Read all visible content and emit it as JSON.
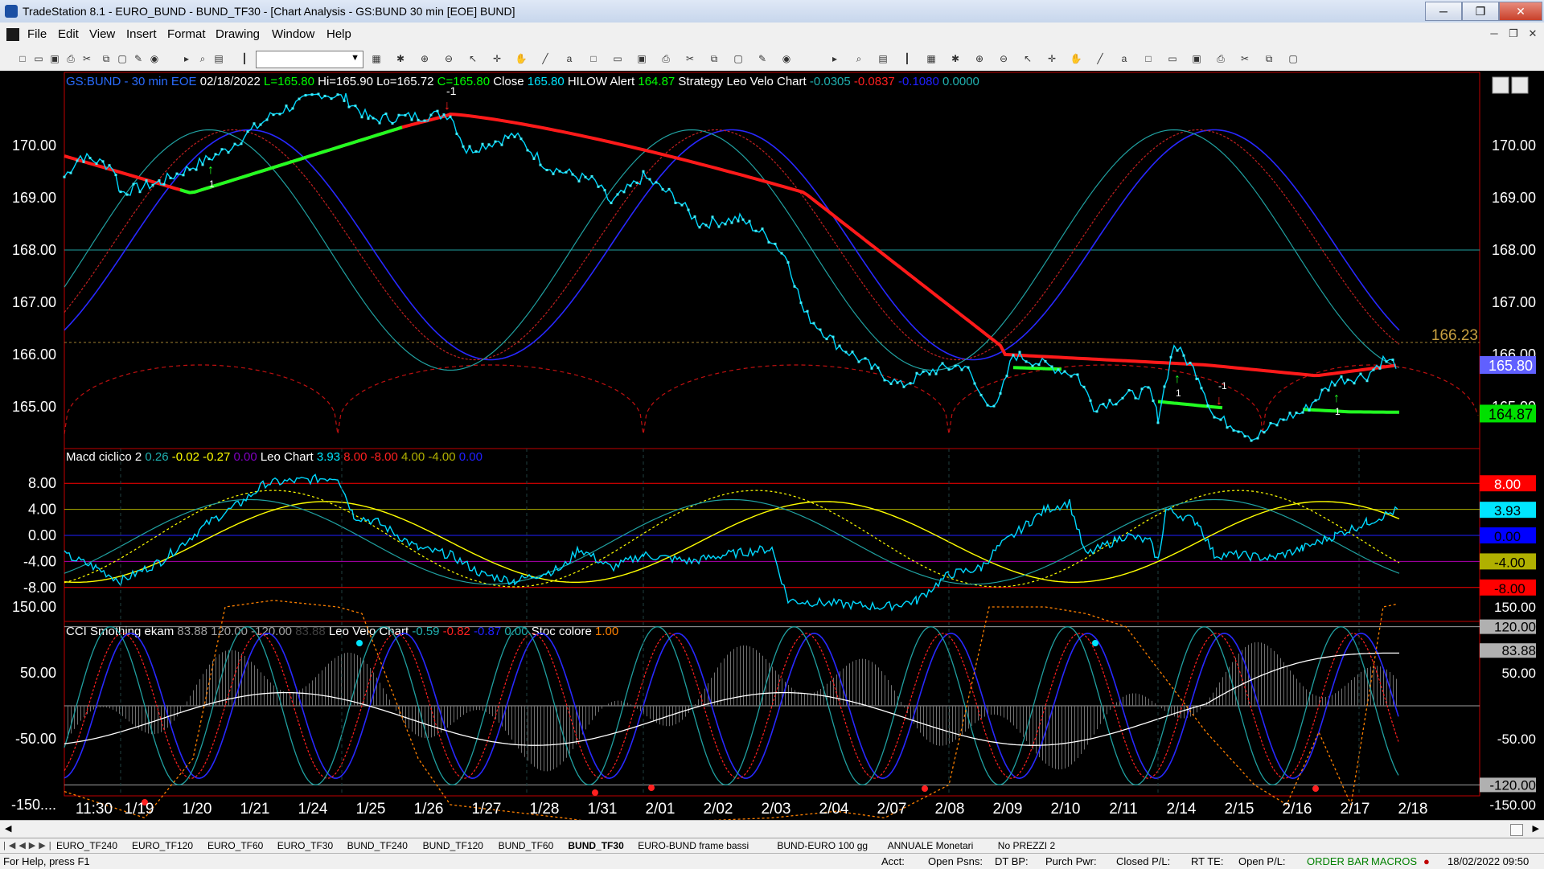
{
  "window": {
    "title": "TradeStation 8.1 - EURO_BUND - BUND_TF30 - [Chart Analysis - GS:BUND  30 min  [EOE] BUND]",
    "min": "─",
    "restore": "❐",
    "close": "✕"
  },
  "menu": [
    "File",
    "Edit",
    "View",
    "Insert",
    "Format",
    "Drawing",
    "Window",
    "Help"
  ],
  "toolbar_icons": [
    "new-icon",
    "open-icon",
    "save-icon",
    "print-icon",
    "cut-icon",
    "copy-icon",
    "lock-icon",
    "draw-icon",
    "color-icon",
    "symbol-combo",
    "arrow-icon",
    "find-icon",
    "chart-icon",
    "bar-icon",
    "table-icon",
    "settings-icon",
    "zoom-in-icon",
    "zoom-out-icon",
    "pointer-icon",
    "crosshair-icon",
    "hand-icon",
    "trendline-icon",
    "text-icon"
  ],
  "chart": {
    "colors": {
      "bg": "#000000",
      "frame": "#c00000",
      "price": "#00e6ff",
      "ma": "#ff1a1a",
      "ma_up": "#22ff22",
      "blue": "#2020ff",
      "teal": "#20b0b0",
      "yellow": "#ffff00",
      "white": "#ffffff",
      "orange": "#ff8000",
      "grey": "#a0a0a0",
      "magenta": "#ff00ff"
    },
    "panel1": {
      "header": [
        {
          "t": "GS:BUND - 30 min",
          "c": "#2a6cff"
        },
        {
          "t": "EOE",
          "c": "#2a6cff"
        },
        {
          "t": "02/18/2022",
          "c": "#ffffff"
        },
        {
          "t": "L=165.80",
          "c": "#00ff00"
        },
        {
          "t": "Hi=165.90",
          "c": "#ffffff"
        },
        {
          "t": "Lo=165.72",
          "c": "#ffffff"
        },
        {
          "t": "C=165.80",
          "c": "#00ff00"
        },
        {
          "t": "Close",
          "c": "#ffffff"
        },
        {
          "t": "165.80",
          "c": "#00e6ff"
        },
        {
          "t": "HILOW Alert",
          "c": "#ffffff"
        },
        {
          "t": "164.87",
          "c": "#00ff00"
        },
        {
          "t": "Strategy",
          "c": "#ffffff"
        },
        {
          "t": "Leo Velo Chart",
          "c": "#ffffff"
        },
        {
          "t": "-0.0305",
          "c": "#20b0b0"
        },
        {
          "t": "-0.0837",
          "c": "#ff2020"
        },
        {
          "t": "-0.1080",
          "c": "#2020ff"
        },
        {
          "t": "0.0000",
          "c": "#20b0b0"
        }
      ],
      "y_labels": [
        "170.00",
        "169.00",
        "168.00",
        "167.00",
        "166.00",
        "165.00"
      ],
      "y_labels_right": [
        "170.00",
        "169.00",
        "168.00",
        "167.00",
        "166.00",
        "165.00"
      ],
      "ref_level": "166.23",
      "last_price": "165.80",
      "hilow_value": "164.87",
      "marker_labels": [
        "-1",
        "1",
        "1",
        "-1",
        "1"
      ]
    },
    "panel2": {
      "header": [
        {
          "t": "Macd ciclico 2",
          "c": "#ffffff"
        },
        {
          "t": "0.26",
          "c": "#20b0b0"
        },
        {
          "t": "-0.02",
          "c": "#ffff00"
        },
        {
          "t": "-0.27",
          "c": "#ffff00"
        },
        {
          "t": "0.00",
          "c": "#8000c0"
        },
        {
          "t": "Leo Chart",
          "c": "#ffffff"
        },
        {
          "t": "3.93",
          "c": "#00e6ff"
        },
        {
          "t": "8.00",
          "c": "#ff2020"
        },
        {
          "t": "-8.00",
          "c": "#ff2020"
        },
        {
          "t": "4.00",
          "c": "#b0b000"
        },
        {
          "t": "-4.00",
          "c": "#b0b000"
        },
        {
          "t": "0.00",
          "c": "#2020ff"
        }
      ],
      "y_labels": [
        "8.00",
        "4.00",
        "0.00",
        "-4.00",
        "-8.00"
      ],
      "right_boxes": [
        {
          "t": "8.00",
          "bg": "#ff0000",
          "c": "#ffffff"
        },
        {
          "t": "3.93",
          "bg": "#00e6ff",
          "c": "#000000"
        },
        {
          "t": "0.00",
          "bg": "#0000ff",
          "c": "#000000"
        },
        {
          "t": "-4.00",
          "bg": "#b0b000",
          "c": "#000000"
        },
        {
          "t": "-8.00",
          "bg": "#ff0000",
          "c": "#000000"
        }
      ]
    },
    "panel3": {
      "header": [
        {
          "t": "CCI Smothing ekam",
          "c": "#ffffff"
        },
        {
          "t": "83.88",
          "c": "#a0a0a0"
        },
        {
          "t": "120.00",
          "c": "#a0a0a0"
        },
        {
          "t": "-120.00",
          "c": "#a0a0a0"
        },
        {
          "t": "83.88",
          "c": "#404040"
        },
        {
          "t": "Leo Velo Chart",
          "c": "#ffffff"
        },
        {
          "t": "-0.59",
          "c": "#20b0b0"
        },
        {
          "t": "-0.82",
          "c": "#ff2020"
        },
        {
          "t": "-0.87",
          "c": "#2020ff"
        },
        {
          "t": "0.00",
          "c": "#20b0b0"
        },
        {
          "t": "Stoc colore",
          "c": "#ffffff"
        },
        {
          "t": "1.00",
          "c": "#ff8000"
        }
      ],
      "y_labels": [
        "150.00",
        "50.00",
        "-50.00",
        "-150...."
      ],
      "right_labels": [
        "150.00",
        "120.00",
        "83.88",
        "50.00",
        "-50.00",
        "-120.00",
        "-150.00"
      ]
    },
    "x_labels": [
      "11:30",
      "1/19",
      "1/20",
      "1/21",
      "1/24",
      "1/25",
      "1/26",
      "1/27",
      "1/28",
      "1/31",
      "2/01",
      "2/02",
      "2/03",
      "2/04",
      "2/07",
      "2/08",
      "2/09",
      "2/10",
      "2/11",
      "2/14",
      "2/15",
      "2/16",
      "2/17",
      "2/18"
    ]
  },
  "sheet_tabs": [
    "EURO_TF240",
    "EURO_TF120",
    "EURO_TF60",
    "EURO_TF30",
    "BUND_TF240",
    "BUND_TF120",
    "BUND_TF60",
    "BUND_TF30",
    "EURO-BUND frame bassi",
    "BUND-EURO 100 gg",
    "ANNUALE Monetari",
    "No PREZZI 2"
  ],
  "active_tab": "BUND_TF30",
  "status": {
    "help": "For Help, press F1",
    "acct": "Acct:",
    "open_psns": "Open Psns:",
    "dt_bp": "DT BP:",
    "purch_pwr": "Purch Pwr:",
    "closed_pl": "Closed P/L:",
    "rt_te": "RT TE:",
    "open_pl": "Open P/L:",
    "order_bar": "ORDER BAR",
    "macros": "MACROS",
    "datetime": "18/02/2022 09:50"
  }
}
